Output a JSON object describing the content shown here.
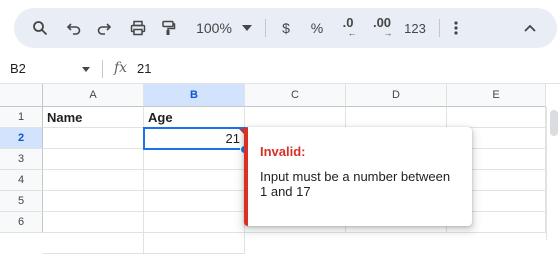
{
  "toolbar": {
    "zoom": "100%",
    "currency_symbol": "$",
    "percent_symbol": "%",
    "decrease_decimal": ".0",
    "increase_decimal": ".00",
    "number_format": "123",
    "icons": [
      "search-icon",
      "undo-icon",
      "redo-icon",
      "print-icon",
      "paint-format-icon",
      "chevron-down-icon",
      "more-vert-icon",
      "collapse-chevron-icon"
    ]
  },
  "formula_bar": {
    "name_box": "B2",
    "fx_label": "fx",
    "value": "21"
  },
  "sheet": {
    "columns": [
      "A",
      "B",
      "C",
      "D",
      "E"
    ],
    "selected_column": "B",
    "rows": [
      "1",
      "2",
      "3",
      "4",
      "5",
      "6"
    ],
    "selected_row": "2",
    "cells": {
      "A1": "Name",
      "B1": "Age",
      "B2": "21"
    }
  },
  "validation": {
    "title": "Invalid:",
    "message": "Input must be a number between 1 and 17",
    "color": "#d93025"
  },
  "colors": {
    "accent": "#1a73e8",
    "toolbar_bg": "#e9eef6",
    "header_selected_bg": "#d3e3fd"
  }
}
